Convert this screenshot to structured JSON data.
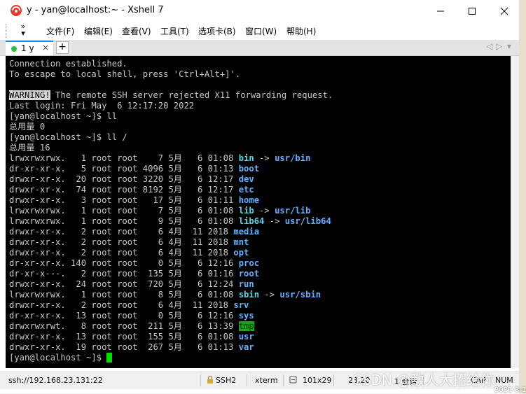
{
  "window": {
    "title": "y - yan@localhost:~ - Xshell 7",
    "controls": {
      "minimize": "—",
      "maximize": "☐",
      "close": "✕"
    }
  },
  "menu": {
    "toolbar_chevron": "»",
    "items": [
      "文件(F)",
      "编辑(E)",
      "查看(V)",
      "工具(T)",
      "选项卡(B)",
      "窗口(W)",
      "帮助(H)"
    ]
  },
  "tabs": {
    "items": [
      {
        "label": "1 y",
        "status_color": "#2bbd4a",
        "active": true
      }
    ],
    "close_glyph": "×",
    "add_glyph": "+",
    "nav_prev": "◁",
    "nav_next": "▷",
    "nav_menu": "▾"
  },
  "terminal": {
    "lines": [
      "Connection established.",
      "To escape to local shell, press 'Ctrl+Alt+]'.",
      "",
      "WARNING! The remote SSH server rejected X11 forwarding request.",
      "Last login: Fri May  6 12:17:20 2022",
      "[yan@localhost ~]$ ll",
      "总用量 0",
      "[yan@localhost ~]$ ll /",
      "总用量 16"
    ],
    "warning_label": "WARNING!",
    "warning_rest": " The remote SSH server rejected X11 forwarding request.",
    "listing": [
      {
        "meta": "lrwxrwxrwx.   1 root root    7 5月   6 01:08 ",
        "name": "bin",
        "style": "cyan",
        "target": "usr/bin"
      },
      {
        "meta": "dr-xr-xr-x.   5 root root 4096 5月   6 01:13 ",
        "name": "boot",
        "style": "blue"
      },
      {
        "meta": "drwxr-xr-x.  20 root root 3220 5月   6 12:17 ",
        "name": "dev",
        "style": "blue"
      },
      {
        "meta": "drwxr-xr-x.  74 root root 8192 5月   6 12:17 ",
        "name": "etc",
        "style": "blue"
      },
      {
        "meta": "drwxr-xr-x.   3 root root   17 5月   6 01:11 ",
        "name": "home",
        "style": "blue"
      },
      {
        "meta": "lrwxrwxrwx.   1 root root    7 5月   6 01:08 ",
        "name": "lib",
        "style": "cyan",
        "target": "usr/lib"
      },
      {
        "meta": "lrwxrwxrwx.   1 root root    9 5月   6 01:08 ",
        "name": "lib64",
        "style": "cyan",
        "target": "usr/lib64"
      },
      {
        "meta": "drwxr-xr-x.   2 root root    6 4月  11 2018 ",
        "name": "media",
        "style": "blue"
      },
      {
        "meta": "drwxr-xr-x.   2 root root    6 4月  11 2018 ",
        "name": "mnt",
        "style": "blue"
      },
      {
        "meta": "drwxr-xr-x.   2 root root    6 4月  11 2018 ",
        "name": "opt",
        "style": "blue"
      },
      {
        "meta": "dr-xr-xr-x. 140 root root    0 5月   6 12:16 ",
        "name": "proc",
        "style": "blue"
      },
      {
        "meta": "dr-xr-x---.   2 root root  135 5月   6 01:16 ",
        "name": "root",
        "style": "blue"
      },
      {
        "meta": "drwxr-xr-x.  24 root root  720 5月   6 12:24 ",
        "name": "run",
        "style": "blue"
      },
      {
        "meta": "lrwxrwxrwx.   1 root root    8 5月   6 01:08 ",
        "name": "sbin",
        "style": "cyan",
        "target": "usr/sbin"
      },
      {
        "meta": "drwxr-xr-x.   2 root root    6 4月  11 2018 ",
        "name": "srv",
        "style": "blue"
      },
      {
        "meta": "dr-xr-xr-x.  13 root root    0 5月   6 12:16 ",
        "name": "sys",
        "style": "blue"
      },
      {
        "meta": "drwxrwxrwt.   8 root root  211 5月   6 13:39 ",
        "name": "tmp",
        "style": "tmp"
      },
      {
        "meta": "drwxr-xr-x.  13 root root  155 5月   6 01:08 ",
        "name": "usr",
        "style": "blue"
      },
      {
        "meta": "drwxr-xr-x.  19 root root  267 5月   6 01:13 ",
        "name": "var",
        "style": "blue"
      }
    ],
    "arrow": " -> ",
    "prompt": "[yan@localhost ~]$ ",
    "colors": {
      "background": "#000000",
      "text": "#c8c8c8",
      "dir": "#5fb0ff",
      "link": "#58d4e8",
      "tmp_bg": "#20a020",
      "cursor": "#00e000"
    }
  },
  "status": {
    "host": "ssh://192.168.23.131:22",
    "protocol": "SSH2",
    "terminal_type": "xterm",
    "size": "101x29",
    "position": "23,20",
    "sessions": "1 会话",
    "caps": "CAP",
    "num": "NUM"
  },
  "overlay": {
    "watermark": "CSDN @敌人大招给你",
    "corner_date": "2021-3-1"
  }
}
